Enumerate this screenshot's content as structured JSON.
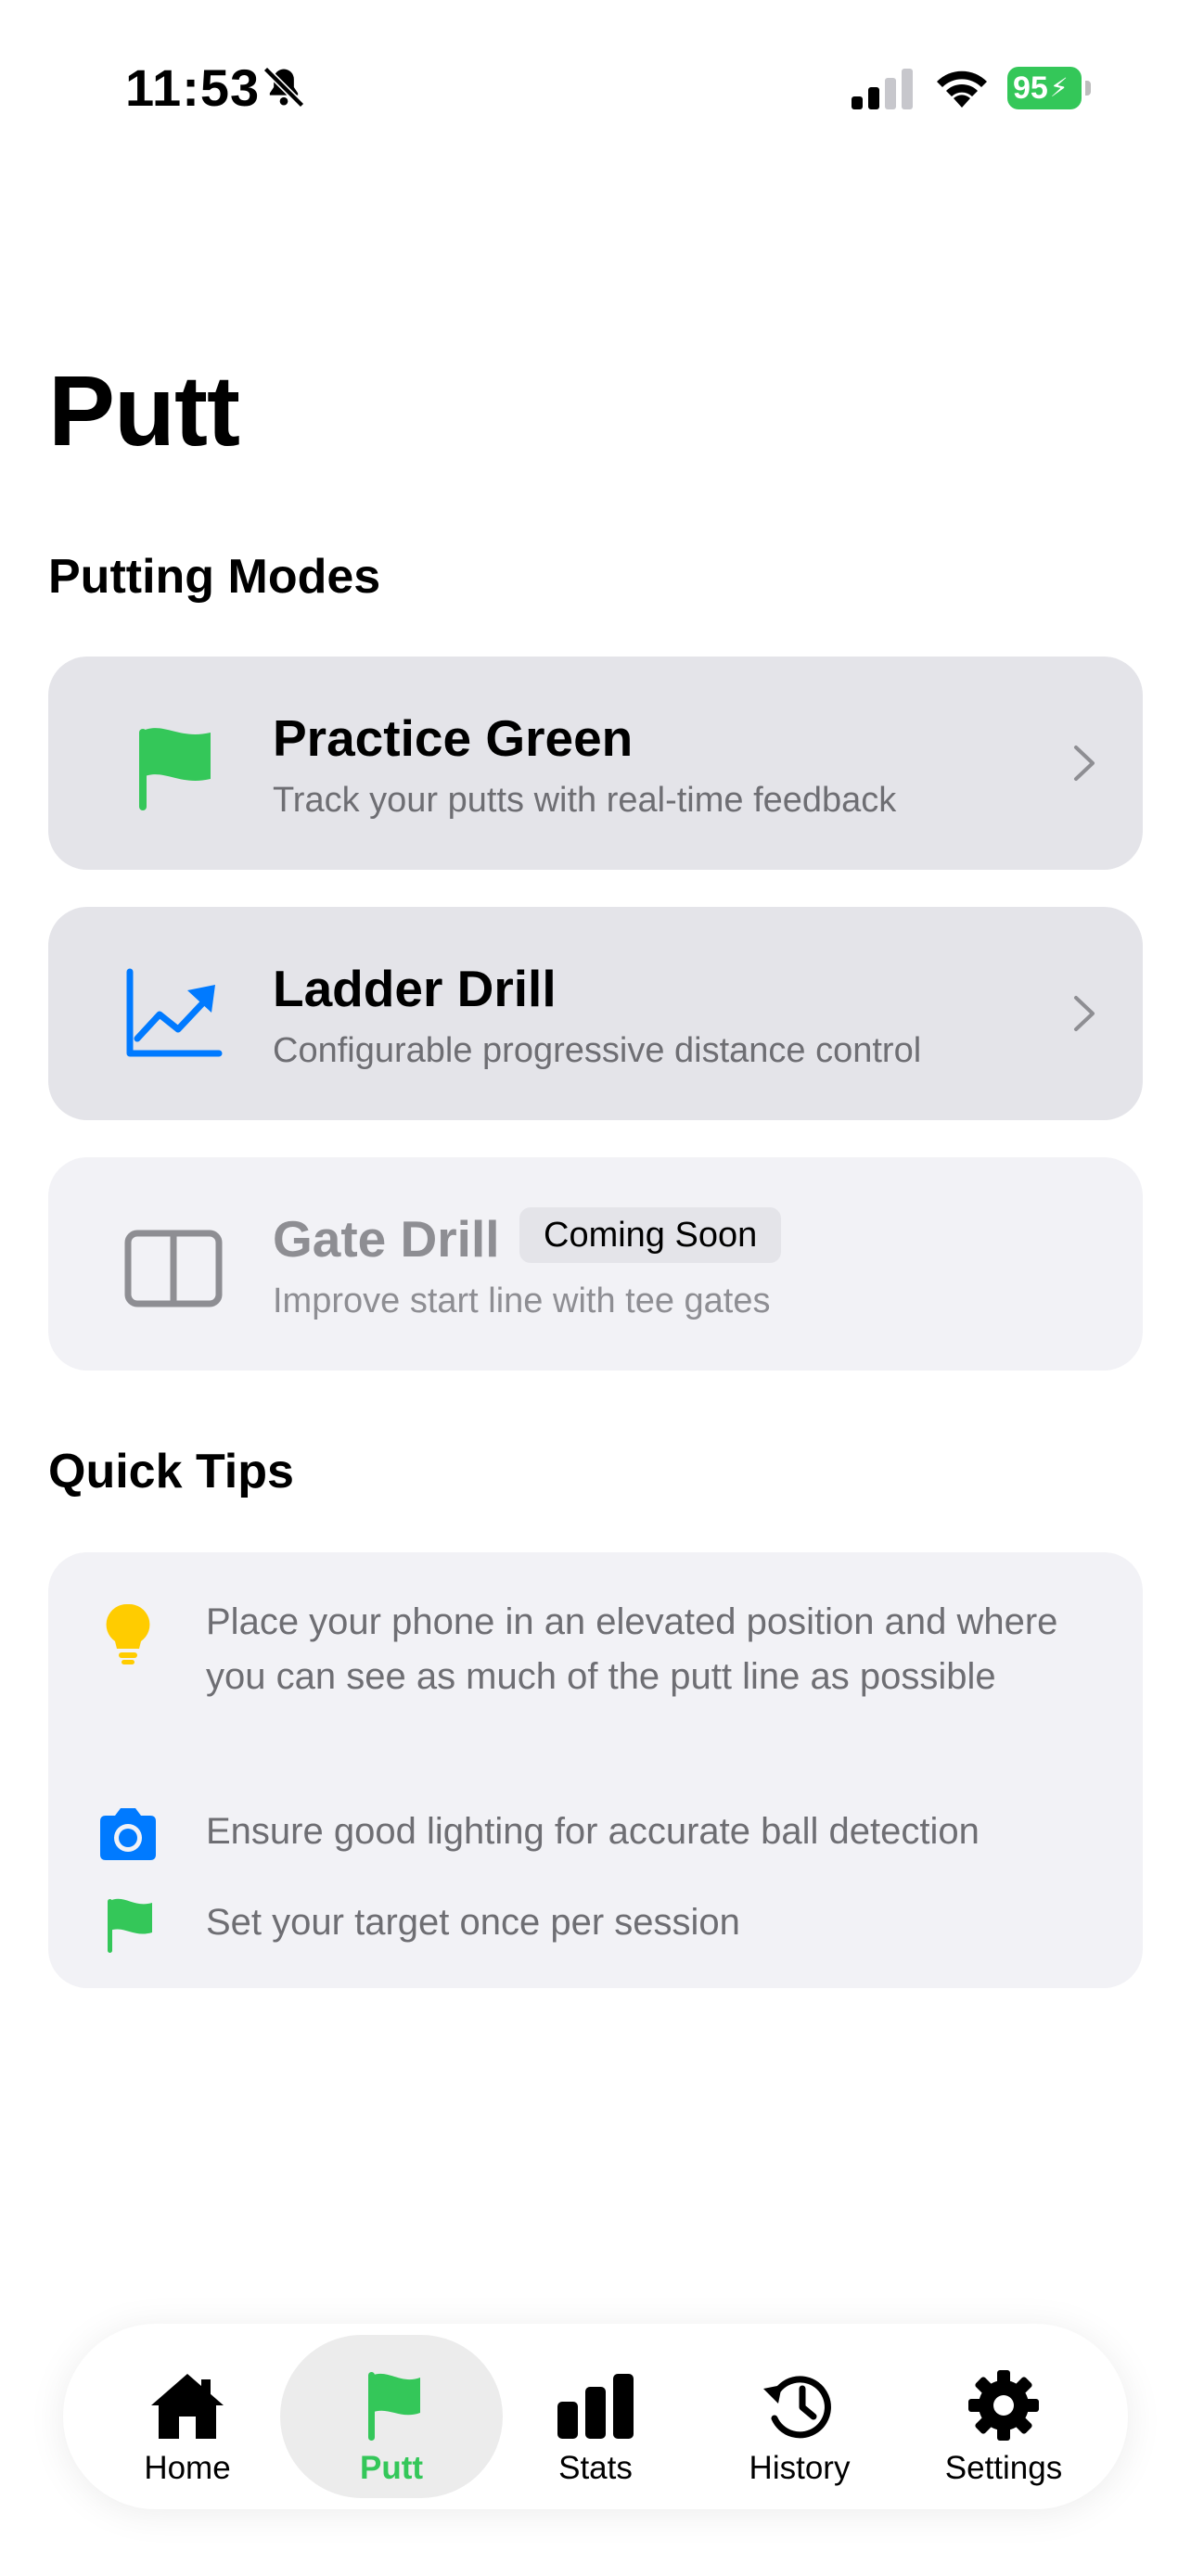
{
  "status_bar": {
    "time": "11:53",
    "battery": "95"
  },
  "page": {
    "title": "Putt"
  },
  "sections": {
    "modes_title": "Putting Modes",
    "tips_title": "Quick Tips"
  },
  "modes": [
    {
      "title": "Practice Green",
      "subtitle": "Track your putts with real-time feedback",
      "icon": "flag-icon"
    },
    {
      "title": "Ladder Drill",
      "subtitle": "Configurable progressive distance control",
      "icon": "chart-line-uptrend-icon"
    },
    {
      "title": "Gate Drill",
      "subtitle": "Improve start line with tee gates",
      "badge": "Coming Soon",
      "icon": "rectangle-split-icon"
    }
  ],
  "tips": [
    {
      "icon": "lightbulb-icon",
      "text": "Place your phone in an elevated position and where you can see as much of the putt line as possible"
    },
    {
      "icon": "camera-icon",
      "text": "Ensure good lighting for accurate ball detection"
    },
    {
      "icon": "flag-icon",
      "text": "Set your target once per session"
    }
  ],
  "tabs": [
    {
      "label": "Home",
      "icon": "house-icon"
    },
    {
      "label": "Putt",
      "icon": "flag-icon"
    },
    {
      "label": "Stats",
      "icon": "bar-chart-icon"
    },
    {
      "label": "History",
      "icon": "clock-history-icon"
    },
    {
      "label": "Settings",
      "icon": "gear-icon"
    }
  ],
  "colors": {
    "accent_green": "#34c759",
    "blue": "#007aff",
    "yellow": "#ffcc00",
    "card_bg": "#e4e4e9",
    "card_disabled_bg": "#f2f2f6"
  }
}
